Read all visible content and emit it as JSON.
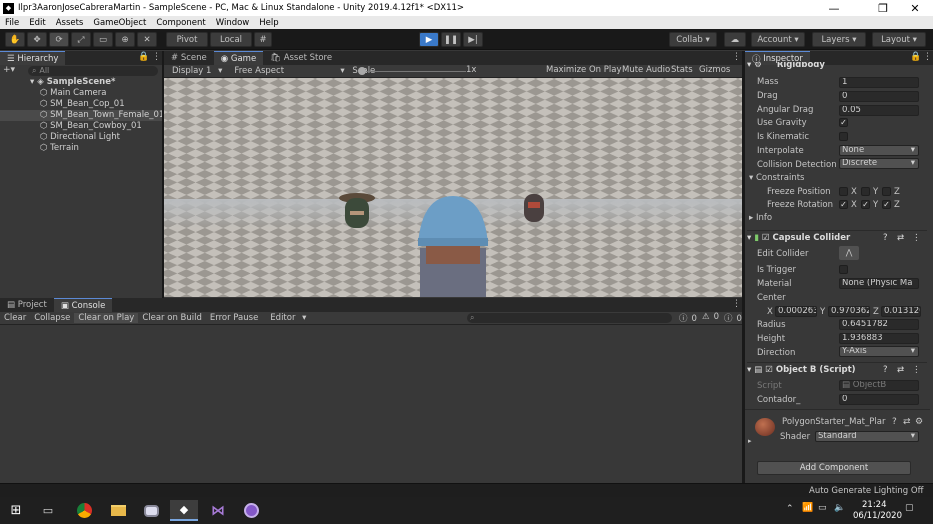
{
  "titlebar": {
    "title": "Ilpr3AaronJoseCabreraMartin - SampleScene - PC, Mac & Linux Standalone - Unity 2019.4.12f1* <DX11>",
    "minimize": "—",
    "maximize": "❐",
    "close": "✕"
  },
  "menu": [
    "File",
    "Edit",
    "Assets",
    "GameObject",
    "Component",
    "Window",
    "Help"
  ],
  "toolbar": {
    "pivot": "Pivot",
    "local": "Local",
    "collab": "Collab",
    "account": "Account",
    "layers": "Layers",
    "layout": "Layout"
  },
  "hierarchy": {
    "tab": "Hierarchy",
    "search_placeholder": "All",
    "scene": "SampleScene*",
    "items": [
      "Main Camera",
      "SM_Bean_Cop_01",
      "SM_Bean_Town_Female_01",
      "SM_Bean_Cowboy_01",
      "Directional Light",
      "Terrain"
    ],
    "selected_index": 2
  },
  "center_tabs": [
    "Scene",
    "Game",
    "Asset Store"
  ],
  "game_bar": {
    "display": "Display 1",
    "aspect": "Free Aspect",
    "scale_label": "Scale",
    "scale_value": "1x",
    "maximize": "Maximize On Play",
    "mute": "Mute Audio",
    "stats": "Stats",
    "gizmos": "Gizmos"
  },
  "console": {
    "tabs": [
      "Project",
      "Console"
    ],
    "buttons": [
      "Clear",
      "Collapse",
      "Clear on Play",
      "Clear on Build",
      "Error Pause",
      "Editor"
    ],
    "counts": [
      "0",
      "0",
      "0"
    ]
  },
  "inspector": {
    "tab": "Inspector",
    "rigidbody": {
      "title": "Rigidbody",
      "mass_label": "Mass",
      "mass": "1",
      "drag_label": "Drag",
      "drag": "0",
      "angular_drag_label": "Angular Drag",
      "angular_drag": "0.05",
      "use_gravity_label": "Use Gravity",
      "is_kinematic_label": "Is Kinematic",
      "interpolate_label": "Interpolate",
      "interpolate": "None",
      "collision_label": "Collision Detection",
      "collision": "Discrete",
      "constraints_label": "Constraints",
      "freeze_pos_label": "Freeze Position",
      "freeze_rot_label": "Freeze Rotation",
      "x": "X",
      "y": "Y",
      "z": "Z",
      "info_label": "Info"
    },
    "capsule": {
      "title": "Capsule Collider",
      "edit_label": "Edit Collider",
      "trigger_label": "Is Trigger",
      "material_label": "Material",
      "material": "None (Physic Ma",
      "center_label": "Center",
      "cx": "0.000263",
      "cy": "0.970362",
      "cz": "0.013126",
      "radius_label": "Radius",
      "radius": "0.6451782",
      "height_label": "Height",
      "height": "1.936883",
      "direction_label": "Direction",
      "direction": "Y-Axis"
    },
    "script": {
      "title": "Object B (Script)",
      "script_label": "Script",
      "script": "ObjectB",
      "contador_label": "Contador_",
      "contador": "0"
    },
    "material": {
      "name": "PolygonStarter_Mat_Plar",
      "shader_label": "Shader",
      "shader": "Standard"
    },
    "add_component": "Add Component"
  },
  "status": "Auto Generate Lighting Off",
  "taskbar": {
    "time": "21:24",
    "date": "06/11/2020"
  }
}
